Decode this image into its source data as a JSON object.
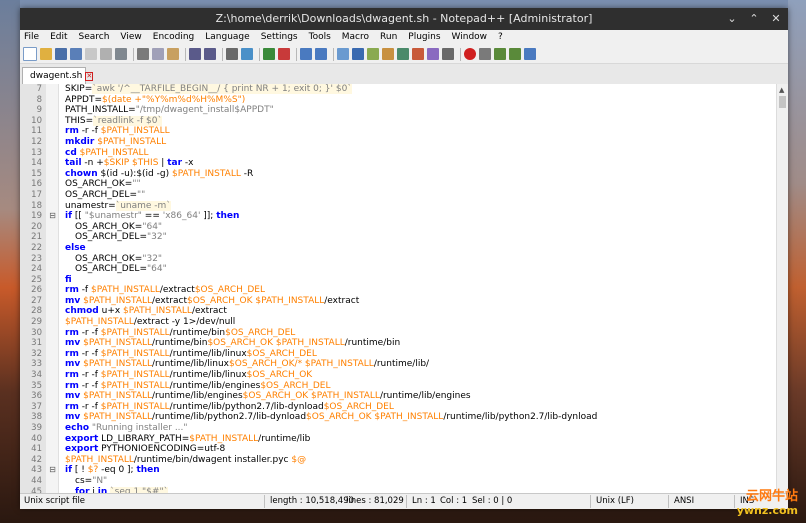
{
  "window": {
    "title": "Z:\\home\\derrik\\Downloads\\dwagent.sh - Notepad++ [Administrator]",
    "controls": [
      "minimize-icon",
      "maximize-icon",
      "close-icon"
    ]
  },
  "menu": [
    "File",
    "Edit",
    "Search",
    "View",
    "Encoding",
    "Language",
    "Settings",
    "Tools",
    "Macro",
    "Run",
    "Plugins",
    "Window",
    "?"
  ],
  "tab": {
    "label": "dwagent.sh"
  },
  "code_lines": [
    {
      "n": "7",
      "fold": "",
      "indent": false,
      "segs": [
        [
          "SKIP=",
          ""
        ],
        [
          "`awk '/^__TARFILE_BEGIN__/ { print NR + 1; exit 0; }' $0`",
          "bt"
        ]
      ]
    },
    {
      "n": "8",
      "fold": "",
      "indent": false,
      "segs": [
        [
          "APPDT=",
          ""
        ],
        [
          "$(date +\"%Y%m%d%H%M%S\")",
          "var"
        ]
      ]
    },
    {
      "n": "9",
      "fold": "",
      "indent": false,
      "segs": [
        [
          "PATH_INSTALL=",
          ""
        ],
        [
          "\"/tmp/dwagent_install$APPDT\"",
          "str"
        ]
      ]
    },
    {
      "n": "10",
      "fold": "",
      "indent": false,
      "segs": [
        [
          "THIS=",
          ""
        ],
        [
          "`readlink -f $0`",
          "bt"
        ]
      ]
    },
    {
      "n": "11",
      "fold": "",
      "indent": false,
      "segs": [
        [
          "rm",
          "kw"
        ],
        [
          " -r -f ",
          ""
        ],
        [
          "$PATH_INSTALL",
          "var"
        ]
      ]
    },
    {
      "n": "12",
      "fold": "",
      "indent": false,
      "segs": [
        [
          "mkdir",
          "kw"
        ],
        [
          " ",
          ""
        ],
        [
          "$PATH_INSTALL",
          "var"
        ]
      ]
    },
    {
      "n": "13",
      "fold": "",
      "indent": false,
      "segs": [
        [
          "cd",
          "kw"
        ],
        [
          " ",
          ""
        ],
        [
          "$PATH_INSTALL",
          "var"
        ]
      ]
    },
    {
      "n": "14",
      "fold": "",
      "indent": false,
      "segs": [
        [
          "tail",
          "kw"
        ],
        [
          " -n +",
          ""
        ],
        [
          "$SKIP $THIS",
          "var"
        ],
        [
          " | ",
          ""
        ],
        [
          "tar",
          "kw"
        ],
        [
          " -x",
          ""
        ]
      ]
    },
    {
      "n": "15",
      "fold": "",
      "indent": false,
      "segs": [
        [
          "chown",
          "kw"
        ],
        [
          " $(id -u):$(id -g) ",
          ""
        ],
        [
          "$PATH_INSTALL",
          "var"
        ],
        [
          " -R",
          ""
        ]
      ]
    },
    {
      "n": "16",
      "fold": "",
      "indent": false,
      "segs": [
        [
          "OS_ARCH_OK=",
          ""
        ],
        [
          "\"\"",
          "str"
        ]
      ]
    },
    {
      "n": "17",
      "fold": "",
      "indent": false,
      "segs": [
        [
          "OS_ARCH_DEL=",
          ""
        ],
        [
          "\"\"",
          "str"
        ]
      ]
    },
    {
      "n": "18",
      "fold": "",
      "indent": false,
      "segs": [
        [
          "unamestr=",
          ""
        ],
        [
          "`uname -m`",
          "bt"
        ]
      ]
    },
    {
      "n": "19",
      "fold": "⊟",
      "indent": false,
      "segs": [
        [
          "if",
          "kw"
        ],
        [
          " [[ ",
          ""
        ],
        [
          "\"$unamestr\"",
          "str"
        ],
        [
          " == ",
          ""
        ],
        [
          "'x86_64'",
          "str"
        ],
        [
          " ]]; ",
          ""
        ],
        [
          "then",
          "kw"
        ]
      ]
    },
    {
      "n": "20",
      "fold": "",
      "indent": true,
      "segs": [
        [
          "OS_ARCH_OK=",
          ""
        ],
        [
          "\"64\"",
          "str"
        ]
      ]
    },
    {
      "n": "21",
      "fold": "",
      "indent": true,
      "segs": [
        [
          "OS_ARCH_DEL=",
          ""
        ],
        [
          "\"32\"",
          "str"
        ]
      ]
    },
    {
      "n": "22",
      "fold": "",
      "indent": false,
      "segs": [
        [
          "else",
          "kw"
        ]
      ]
    },
    {
      "n": "23",
      "fold": "",
      "indent": true,
      "segs": [
        [
          "OS_ARCH_OK=",
          ""
        ],
        [
          "\"32\"",
          "str"
        ]
      ]
    },
    {
      "n": "24",
      "fold": "",
      "indent": true,
      "segs": [
        [
          "OS_ARCH_DEL=",
          ""
        ],
        [
          "\"64\"",
          "str"
        ]
      ]
    },
    {
      "n": "25",
      "fold": "",
      "indent": false,
      "segs": [
        [
          "fi",
          "kw"
        ]
      ]
    },
    {
      "n": "26",
      "fold": "",
      "indent": false,
      "segs": [
        [
          "rm",
          "kw"
        ],
        [
          " -f ",
          ""
        ],
        [
          "$PATH_INSTALL",
          "var"
        ],
        [
          "/extract",
          ""
        ],
        [
          "$OS_ARCH_DEL",
          "var"
        ]
      ]
    },
    {
      "n": "27",
      "fold": "",
      "indent": false,
      "segs": [
        [
          "mv",
          "kw"
        ],
        [
          " ",
          ""
        ],
        [
          "$PATH_INSTALL",
          "var"
        ],
        [
          "/extract",
          ""
        ],
        [
          "$OS_ARCH_OK $PATH_INSTALL",
          "var"
        ],
        [
          "/extract",
          ""
        ]
      ]
    },
    {
      "n": "28",
      "fold": "",
      "indent": false,
      "segs": [
        [
          "chmod",
          "kw"
        ],
        [
          " u+x ",
          ""
        ],
        [
          "$PATH_INSTALL",
          "var"
        ],
        [
          "/extract",
          ""
        ]
      ]
    },
    {
      "n": "29",
      "fold": "",
      "indent": false,
      "segs": [
        [
          "$PATH_INSTALL",
          "var"
        ],
        [
          "/extract -y 1>/dev/null",
          ""
        ]
      ]
    },
    {
      "n": "30",
      "fold": "",
      "indent": false,
      "segs": [
        [
          "rm",
          "kw"
        ],
        [
          " -r -f ",
          ""
        ],
        [
          "$PATH_INSTALL",
          "var"
        ],
        [
          "/runtime/bin",
          ""
        ],
        [
          "$OS_ARCH_DEL",
          "var"
        ]
      ]
    },
    {
      "n": "31",
      "fold": "",
      "indent": false,
      "segs": [
        [
          "mv",
          "kw"
        ],
        [
          " ",
          ""
        ],
        [
          "$PATH_INSTALL",
          "var"
        ],
        [
          "/runtime/bin",
          ""
        ],
        [
          "$OS_ARCH_OK $PATH_INSTALL",
          "var"
        ],
        [
          "/runtime/bin",
          ""
        ]
      ]
    },
    {
      "n": "32",
      "fold": "",
      "indent": false,
      "segs": [
        [
          "rm",
          "kw"
        ],
        [
          " -r -f ",
          ""
        ],
        [
          "$PATH_INSTALL",
          "var"
        ],
        [
          "/runtime/lib/linux",
          ""
        ],
        [
          "$OS_ARCH_DEL",
          "var"
        ]
      ]
    },
    {
      "n": "33",
      "fold": "",
      "indent": false,
      "segs": [
        [
          "mv",
          "kw"
        ],
        [
          " ",
          ""
        ],
        [
          "$PATH_INSTALL",
          "var"
        ],
        [
          "/runtime/lib/linux",
          ""
        ],
        [
          "$OS_ARCH_OK/* $PATH_INSTALL",
          "var"
        ],
        [
          "/runtime/lib/",
          ""
        ]
      ]
    },
    {
      "n": "34",
      "fold": "",
      "indent": false,
      "segs": [
        [
          "rm",
          "kw"
        ],
        [
          " -r -f ",
          ""
        ],
        [
          "$PATH_INSTALL",
          "var"
        ],
        [
          "/runtime/lib/linux",
          ""
        ],
        [
          "$OS_ARCH_OK",
          "var"
        ]
      ]
    },
    {
      "n": "35",
      "fold": "",
      "indent": false,
      "segs": [
        [
          "rm",
          "kw"
        ],
        [
          " -r -f ",
          ""
        ],
        [
          "$PATH_INSTALL",
          "var"
        ],
        [
          "/runtime/lib/engines",
          ""
        ],
        [
          "$OS_ARCH_DEL",
          "var"
        ]
      ]
    },
    {
      "n": "36",
      "fold": "",
      "indent": false,
      "segs": [
        [
          "mv",
          "kw"
        ],
        [
          " ",
          ""
        ],
        [
          "$PATH_INSTALL",
          "var"
        ],
        [
          "/runtime/lib/engines",
          ""
        ],
        [
          "$OS_ARCH_OK $PATH_INSTALL",
          "var"
        ],
        [
          "/runtime/lib/engines",
          ""
        ]
      ]
    },
    {
      "n": "37",
      "fold": "",
      "indent": false,
      "segs": [
        [
          "rm",
          "kw"
        ],
        [
          " -r -f ",
          ""
        ],
        [
          "$PATH_INSTALL",
          "var"
        ],
        [
          "/runtime/lib/python2.7/lib-dynload",
          ""
        ],
        [
          "$OS_ARCH_DEL",
          "var"
        ]
      ]
    },
    {
      "n": "38",
      "fold": "",
      "indent": false,
      "segs": [
        [
          "mv",
          "kw"
        ],
        [
          " ",
          ""
        ],
        [
          "$PATH_INSTALL",
          "var"
        ],
        [
          "/runtime/lib/python2.7/lib-dynload",
          ""
        ],
        [
          "$OS_ARCH_OK $PATH_INSTALL",
          "var"
        ],
        [
          "/runtime/lib/python2.7/lib-dynload",
          ""
        ]
      ]
    },
    {
      "n": "39",
      "fold": "",
      "indent": false,
      "segs": [
        [
          "echo",
          "kw"
        ],
        [
          " ",
          ""
        ],
        [
          "\"Running installer ...\"",
          "str"
        ]
      ]
    },
    {
      "n": "40",
      "fold": "",
      "indent": false,
      "segs": [
        [
          "export",
          "kw"
        ],
        [
          " LD_LIBRARY_PATH=",
          ""
        ],
        [
          "$PATH_INSTALL",
          "var"
        ],
        [
          "/runtime/lib",
          ""
        ]
      ]
    },
    {
      "n": "41",
      "fold": "",
      "indent": false,
      "segs": [
        [
          "export",
          "kw"
        ],
        [
          " PYTHONIOENCODING=utf-8",
          ""
        ]
      ]
    },
    {
      "n": "42",
      "fold": "",
      "indent": false,
      "segs": [
        [
          "$PATH_INSTALL",
          "var"
        ],
        [
          "/runtime/bin/dwagent installer.pyc ",
          ""
        ],
        [
          "$@",
          "var"
        ]
      ]
    },
    {
      "n": "43",
      "fold": "⊟",
      "indent": false,
      "segs": [
        [
          "if",
          "kw"
        ],
        [
          " [ ! ",
          ""
        ],
        [
          "$?",
          "var"
        ],
        [
          " -eq 0 ]; ",
          ""
        ],
        [
          "then",
          "kw"
        ]
      ]
    },
    {
      "n": "44",
      "fold": "",
      "indent": true,
      "segs": [
        [
          "cs=",
          ""
        ],
        [
          "\"N\"",
          "str"
        ]
      ]
    },
    {
      "n": "45",
      "fold": "",
      "indent": true,
      "segs": [
        [
          "for",
          "kw"
        ],
        [
          " i ",
          ""
        ],
        [
          "in",
          "kw"
        ],
        [
          " ",
          ""
        ],
        [
          "`seq 1 \"$#\"`",
          "bt"
        ]
      ]
    }
  ],
  "status": {
    "file_type": "Unix script file",
    "length": "length : 10,518,490",
    "lines": "lines : 81,029",
    "ln": "Ln : 1",
    "col": "Col : 1",
    "sel": "Sel : 0 | 0",
    "eol": "Unix (LF)",
    "encoding": "ANSI",
    "mode": "INS"
  },
  "watermark": {
    "line1": "云网牛站",
    "line2": "ywnz.com"
  },
  "colors": {
    "keyword": "#0000ff",
    "variable": "#ff8000",
    "string": "#808080",
    "titlebar": "#2f2f2f"
  }
}
